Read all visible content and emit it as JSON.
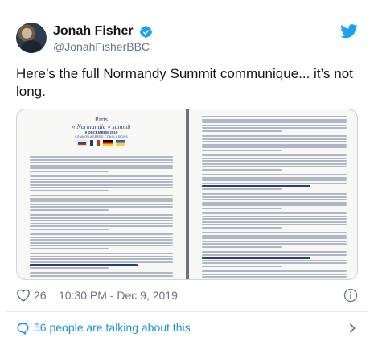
{
  "author": {
    "display_name": "Jonah Fisher",
    "handle": "@JonahFisherBBC",
    "avatar_icon": "profile-photo",
    "verified_icon": "verified-badge-icon"
  },
  "tweet": {
    "text": "Here’s the full Normandy Summit communique... it’s not long."
  },
  "media": {
    "left_page": {
      "title_line1": "Paris",
      "title_line2": "« Normandie » summit",
      "date": "9 DÉCEMBRE 2019",
      "subtitle": "COMMON AGREED CONCLUSIONS",
      "flags": [
        "Russia",
        "France",
        "Germany",
        "Ukraine"
      ]
    },
    "right_page": {}
  },
  "footer": {
    "like_count": "26",
    "timestamp": "10:30 PM - Dec 9, 2019",
    "talking_text": "56 people are talking about this"
  },
  "colors": {
    "accent": "#1da1f2",
    "link": "#1b95e0",
    "text": "#14171a",
    "muted": "#657786",
    "document_ink": "#2a3f7a"
  }
}
